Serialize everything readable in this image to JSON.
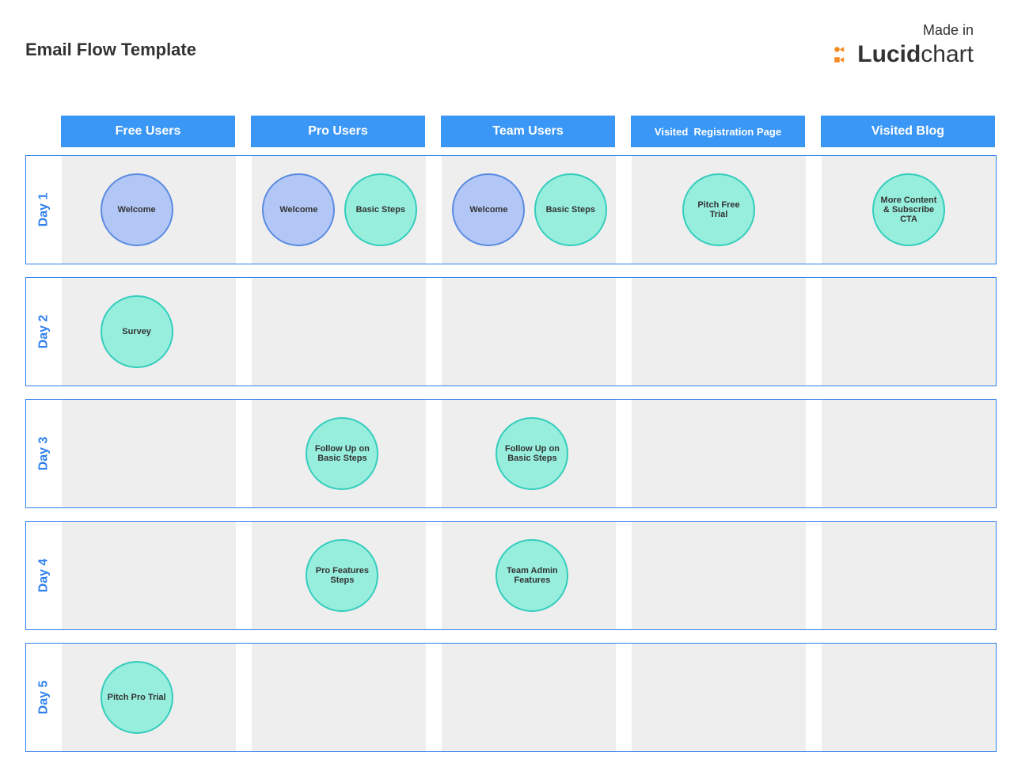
{
  "title": "Email Flow Template",
  "madein": "Made in",
  "brand_bold": "Lucid",
  "brand_light": "chart",
  "columns": [
    {
      "id": "free",
      "label": "Free Users"
    },
    {
      "id": "pro",
      "label": "Pro Users"
    },
    {
      "id": "team",
      "label": "Team Users"
    },
    {
      "id": "reg",
      "label": "Visited  Registration Page"
    },
    {
      "id": "blog",
      "label": "Visited Blog"
    }
  ],
  "rows": [
    {
      "id": "day1",
      "label": "Day 1"
    },
    {
      "id": "day2",
      "label": "Day 2"
    },
    {
      "id": "day3",
      "label": "Day 3"
    },
    {
      "id": "day4",
      "label": "Day 4"
    },
    {
      "id": "day5",
      "label": "Day 5"
    }
  ],
  "cells": {
    "day1": {
      "free": [
        {
          "text": "Welcome",
          "style": "blue"
        }
      ],
      "pro": [
        {
          "text": "Welcome",
          "style": "blue"
        },
        {
          "text": "Basic Steps",
          "style": "mint"
        }
      ],
      "team": [
        {
          "text": "Welcome",
          "style": "blue"
        },
        {
          "text": "Basic Steps",
          "style": "mint"
        }
      ],
      "reg": [
        {
          "text": "Pitch Free Trial",
          "style": "mint"
        }
      ],
      "blog": [
        {
          "text": "More Content & Subscribe CTA",
          "style": "mint"
        }
      ]
    },
    "day2": {
      "free": [
        {
          "text": "Survey",
          "style": "mint"
        }
      ]
    },
    "day3": {
      "pro": [
        {
          "text": "Follow Up on Basic Steps",
          "style": "mint"
        }
      ],
      "team": [
        {
          "text": "Follow Up on Basic Steps",
          "style": "mint"
        }
      ]
    },
    "day4": {
      "pro": [
        {
          "text": "Pro Features Steps",
          "style": "mint"
        }
      ],
      "team": [
        {
          "text": "Team Admin Features",
          "style": "mint"
        }
      ]
    },
    "day5": {
      "free": [
        {
          "text": "Pitch Pro Trial",
          "style": "mint"
        }
      ]
    }
  },
  "colors": {
    "blue_header": "#3b97f6",
    "border": "#2f80ed",
    "mint": "#97eedd",
    "lav": "#b3c7f7"
  }
}
